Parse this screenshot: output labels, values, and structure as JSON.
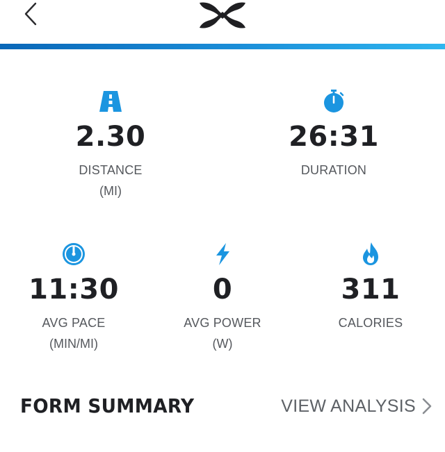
{
  "header": {
    "back_icon": "chevron-left-icon",
    "logo_icon": "under-armour-logo",
    "accent_colors": [
      "#0a67b8",
      "#2fb6ef"
    ]
  },
  "stats": {
    "distance": {
      "icon": "road-icon",
      "value": "2.30",
      "label": "DISTANCE",
      "unit": "(MI)"
    },
    "duration": {
      "icon": "stopwatch-icon",
      "value": "26:31",
      "label": "DURATION",
      "unit": ""
    },
    "pace": {
      "icon": "speedometer-icon",
      "value": "11:30",
      "label": "AVG PACE",
      "unit": "(MIN/MI)"
    },
    "power": {
      "icon": "lightning-icon",
      "value": "0",
      "label": "AVG POWER",
      "unit": "(W)"
    },
    "calories": {
      "icon": "flame-icon",
      "value": "311",
      "label": "CALORIES",
      "unit": ""
    }
  },
  "form_summary": {
    "title": "FORM SUMMARY",
    "link_label": "VIEW ANALYSIS",
    "link_icon": "chevron-right-icon"
  },
  "colors": {
    "icon_blue": "#1b95e0",
    "text_dark": "#1f2024",
    "text_muted": "#55585d"
  }
}
